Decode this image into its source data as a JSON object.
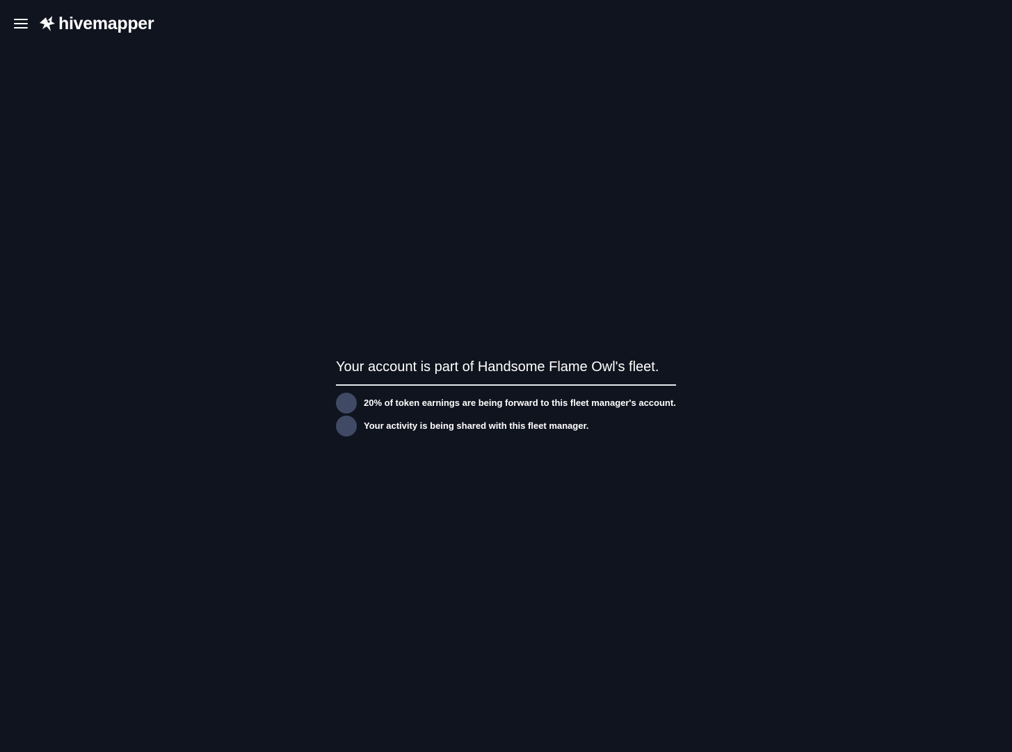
{
  "header": {
    "menu_icon": "hamburger-menu-icon",
    "logo_icon": "hivemapper-logo-icon",
    "logo_text": "hivemapper"
  },
  "fleet": {
    "title": "Your account is part of Handsome Flame Owl's fleet.",
    "items": [
      {
        "icon": "status-dot",
        "text": "20% of token earnings are being forward to this fleet manager's account."
      },
      {
        "icon": "status-dot",
        "text": "Your activity is being shared with this fleet manager."
      }
    ]
  },
  "colors": {
    "background": "#10141e",
    "text": "#ffffff",
    "dot": "#404a64",
    "divider": "#e6e8ee"
  }
}
